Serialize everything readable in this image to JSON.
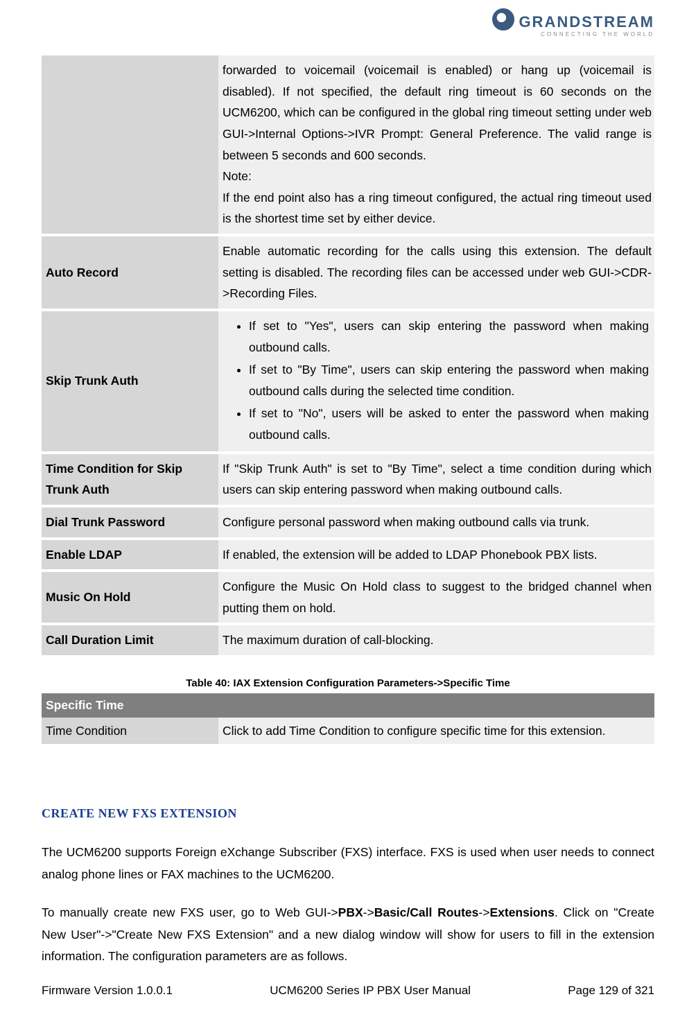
{
  "logo": {
    "brand": "GRANDSTREAM",
    "tagline": "CONNECTING THE WORLD"
  },
  "table1": {
    "rows": [
      {
        "label": "",
        "desc_html": "forwarded to voicemail (voicemail is enabled) or hang up (voicemail is disabled). If not specified, the default ring timeout is 60 seconds on the UCM6200, which can be configured in the global ring timeout setting under web GUI->Internal Options->IVR Prompt: General Preference. The valid range is between 5 seconds and 600 seconds.<br>Note:<br>If the end point also has a ring timeout configured, the actual ring timeout used is the shortest time set by either device."
      },
      {
        "label": "Auto Record",
        "desc": "Enable automatic recording for the calls using this extension. The default setting is disabled. The recording files can be accessed under web GUI->CDR->Recording Files."
      },
      {
        "label": "Skip Trunk Auth",
        "bullets": [
          "If set to \"Yes\", users can skip entering the password when making outbound calls.",
          "If set to \"By Time\", users can skip entering the password when making outbound calls during the selected time condition.",
          "If set to \"No\", users will be asked to enter the password when making outbound calls."
        ]
      },
      {
        "label": "Time Condition for Skip Trunk Auth",
        "desc": "If \"Skip Trunk Auth\" is set to \"By Time\", select a time condition during which users can skip entering password when making outbound calls."
      },
      {
        "label": "Dial Trunk Password",
        "desc": "Configure personal password when making outbound calls via trunk."
      },
      {
        "label": "Enable LDAP",
        "desc": "If enabled, the extension will be added to LDAP Phonebook PBX lists."
      },
      {
        "label": "Music On Hold",
        "desc": "Configure the Music On Hold class to suggest to the bridged channel when putting them on hold."
      },
      {
        "label": "Call Duration Limit",
        "desc": "The maximum duration of call-blocking."
      }
    ]
  },
  "table2_caption": "Table 40: IAX Extension Configuration Parameters->Specific Time",
  "table2": {
    "header": "Specific Time",
    "row_label": "Time Condition",
    "row_desc": "Click to add Time Condition to configure specific time for this extension."
  },
  "section_heading": "CREATE NEW FXS EXTENSION",
  "para1": "The UCM6200 supports Foreign eXchange Subscriber (FXS) interface. FXS is used when user needs to connect analog phone lines or FAX machines to the UCM6200.",
  "para2_parts": {
    "p1": "To manually create new FXS user, go to Web GUI->",
    "b1": "PBX",
    "a1": "->",
    "b2": "Basic/Call Routes",
    "a2": "->",
    "b3": "Extensions",
    "p2": ". Click on \"Create New User\"->\"Create New FXS Extension\" and a new dialog window will show for users to fill in the extension information. The configuration parameters are as follows."
  },
  "footer": {
    "left": "Firmware Version 1.0.0.1",
    "center": "UCM6200 Series IP PBX User Manual",
    "right": "Page 129 of 321"
  }
}
